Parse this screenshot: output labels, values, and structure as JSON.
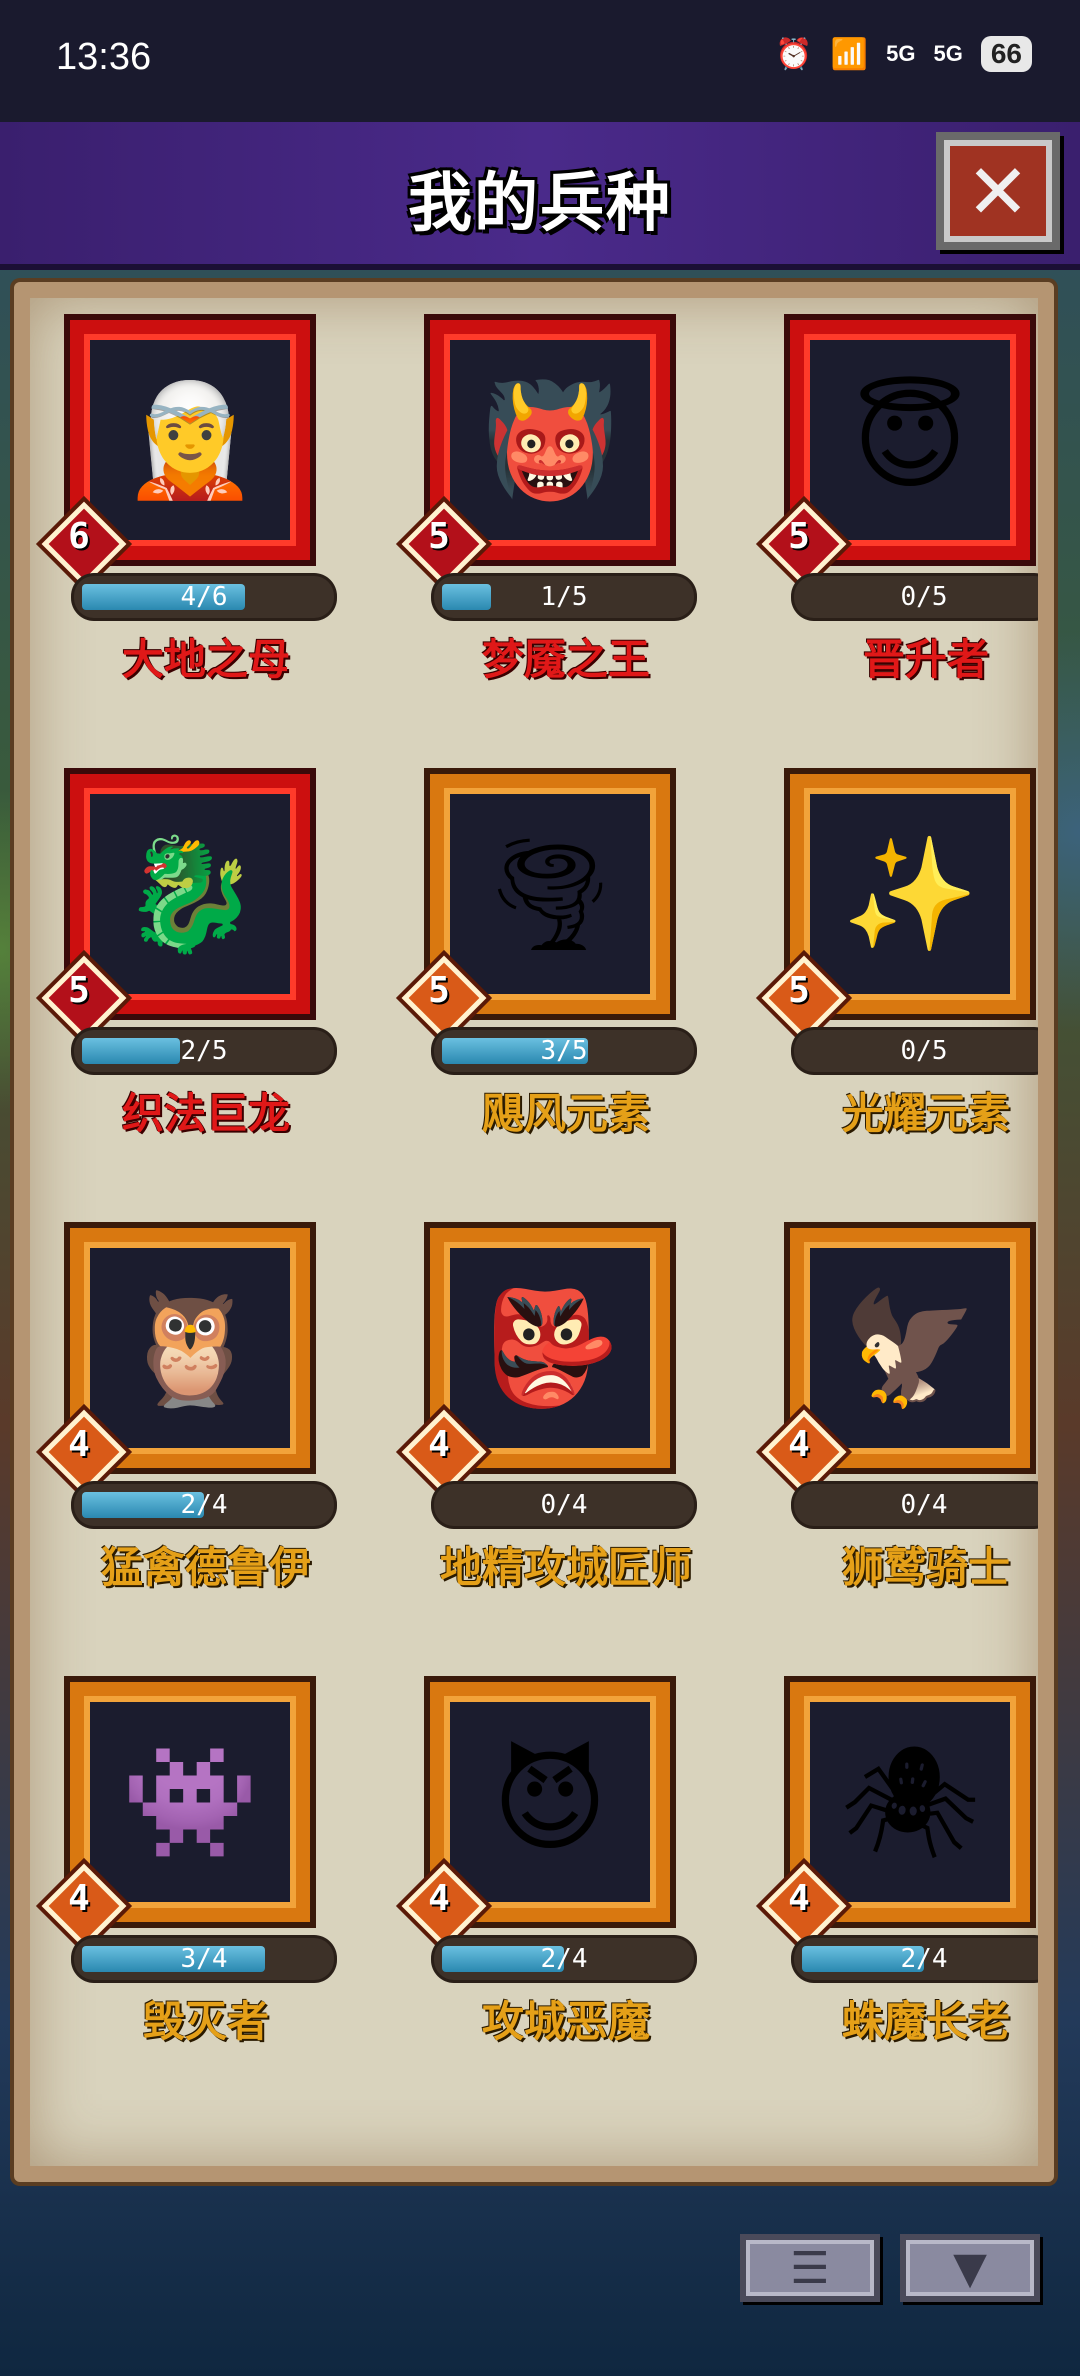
{
  "status": {
    "time": "13:36",
    "alarm_icon": "alarm-icon",
    "wifi_icon": "wifi-icon",
    "net1": "5G",
    "net2": "5G",
    "battery": "66"
  },
  "header": {
    "title": "我的兵种",
    "close_icon": "close-icon"
  },
  "units": [
    {
      "name": "大地之母",
      "tier": "6",
      "progress": "4/6",
      "fill": 0.67,
      "rarity": "red",
      "icon": "🧝"
    },
    {
      "name": "梦魇之王",
      "tier": "5",
      "progress": "1/5",
      "fill": 0.2,
      "rarity": "red",
      "icon": "👹"
    },
    {
      "name": "晋升者",
      "tier": "5",
      "progress": "0/5",
      "fill": 0,
      "rarity": "red",
      "icon": "😇"
    },
    {
      "name": "织法巨龙",
      "tier": "5",
      "progress": "2/5",
      "fill": 0.4,
      "rarity": "red",
      "icon": "🐉"
    },
    {
      "name": "飓风元素",
      "tier": "5",
      "progress": "3/5",
      "fill": 0.6,
      "rarity": "orange",
      "icon": "🌪"
    },
    {
      "name": "光耀元素",
      "tier": "5",
      "progress": "0/5",
      "fill": 0,
      "rarity": "orange",
      "icon": "✨"
    },
    {
      "name": "猛禽德鲁伊",
      "tier": "4",
      "progress": "2/4",
      "fill": 0.5,
      "rarity": "orange",
      "icon": "🦉"
    },
    {
      "name": "地精攻城匠师",
      "tier": "4",
      "progress": "0/4",
      "fill": 0,
      "rarity": "orange",
      "icon": "👺"
    },
    {
      "name": "狮鹫骑士",
      "tier": "4",
      "progress": "0/4",
      "fill": 0,
      "rarity": "orange",
      "icon": "🦅"
    },
    {
      "name": "毁灭者",
      "tier": "4",
      "progress": "3/4",
      "fill": 0.75,
      "rarity": "orange",
      "icon": "👾"
    },
    {
      "name": "攻城恶魔",
      "tier": "4",
      "progress": "2/4",
      "fill": 0.5,
      "rarity": "orange",
      "icon": "😈"
    },
    {
      "name": "蛛魔长老",
      "tier": "4",
      "progress": "2/4",
      "fill": 0.5,
      "rarity": "orange",
      "icon": "🕷"
    }
  ],
  "footer": {
    "list_icon": "list-icon",
    "filter_icon": "filter-icon"
  }
}
